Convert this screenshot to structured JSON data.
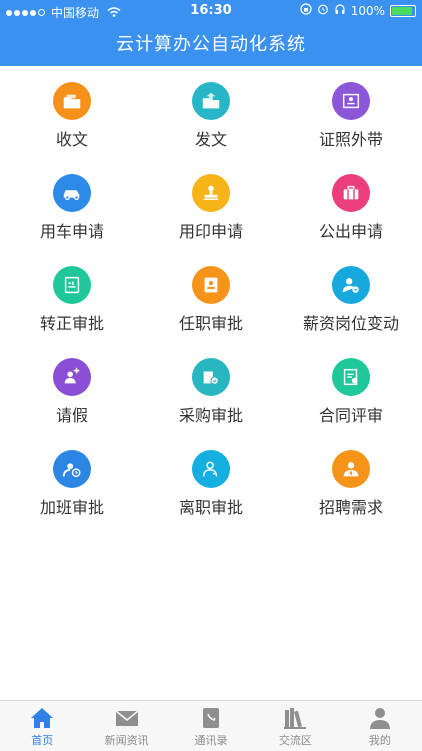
{
  "status_bar": {
    "carrier": "中国移动",
    "time": "16:30",
    "battery": "100%",
    "battery_level": 1.0
  },
  "header": {
    "title": "云计算办公自动化系统"
  },
  "grid": {
    "items": [
      {
        "label": "收文",
        "icon": "receive-doc-icon",
        "color": "#f5901a"
      },
      {
        "label": "发文",
        "icon": "send-doc-icon",
        "color": "#26b6c7"
      },
      {
        "label": "证照外带",
        "icon": "certificate-icon",
        "color": "#8b56d8"
      },
      {
        "label": "用车申请",
        "icon": "car-icon",
        "color": "#2d8ae6"
      },
      {
        "label": "用印申请",
        "icon": "stamp-icon",
        "color": "#f6b419"
      },
      {
        "label": "公出申请",
        "icon": "suitcase-icon",
        "color": "#ea3f7b"
      },
      {
        "label": "转正审批",
        "icon": "regularize-icon",
        "color": "#1fc79a"
      },
      {
        "label": "任职审批",
        "icon": "appointment-icon",
        "color": "#f59419"
      },
      {
        "label": "薪资岗位变动",
        "icon": "salary-change-icon",
        "color": "#17a9dd"
      },
      {
        "label": "请假",
        "icon": "leave-icon",
        "color": "#8b4fd6"
      },
      {
        "label": "采购审批",
        "icon": "purchase-icon",
        "color": "#28b7c1"
      },
      {
        "label": "合同评审",
        "icon": "contract-icon",
        "color": "#1fc79a"
      },
      {
        "label": "加班审批",
        "icon": "overtime-icon",
        "color": "#2d86e4"
      },
      {
        "label": "离职审批",
        "icon": "resign-icon",
        "color": "#14aee0"
      },
      {
        "label": "招聘需求",
        "icon": "recruit-icon",
        "color": "#f59419"
      }
    ]
  },
  "tabbar": {
    "active_color": "#2f80e7",
    "tabs": [
      {
        "label": "首页",
        "icon": "home-icon"
      },
      {
        "label": "新闻资讯",
        "icon": "mail-icon"
      },
      {
        "label": "通讯录",
        "icon": "contacts-icon"
      },
      {
        "label": "交流区",
        "icon": "books-icon"
      },
      {
        "label": "我的",
        "icon": "person-icon"
      }
    ]
  }
}
